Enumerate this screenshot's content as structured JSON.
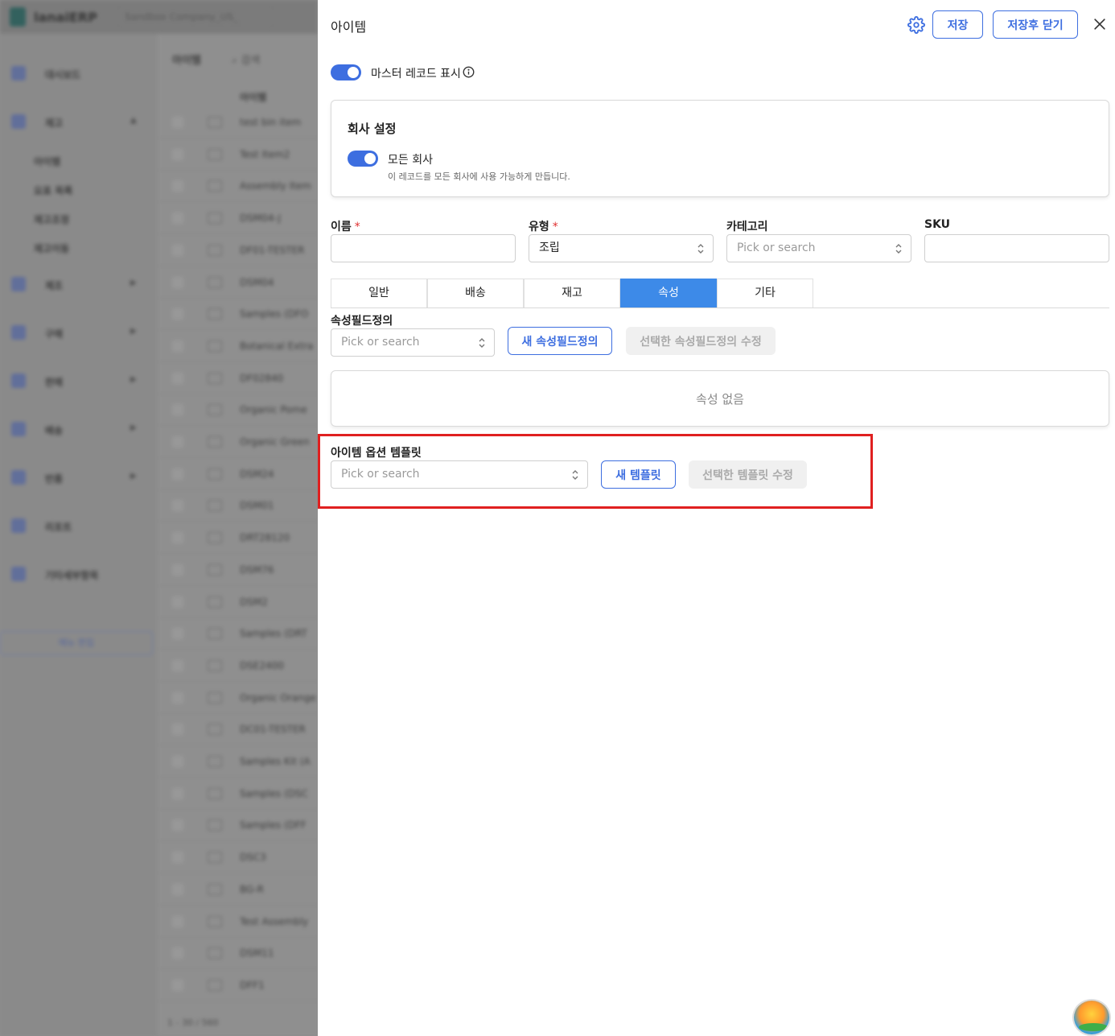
{
  "background": {
    "brand": "lanaiERP",
    "company": "Sandbox Company_US_",
    "sidebar": [
      {
        "label": "대시보드",
        "has_children": false
      },
      {
        "label": "재고",
        "has_children": true
      },
      {
        "label": "제조",
        "has_children": true
      },
      {
        "label": "구매",
        "has_children": true
      },
      {
        "label": "판매",
        "has_children": true
      },
      {
        "label": "배송",
        "has_children": true
      },
      {
        "label": "반품",
        "has_children": true
      },
      {
        "label": "리포트",
        "has_children": false
      },
      {
        "label": "기타세부항목",
        "has_children": false
      }
    ],
    "sidebar_sub": [
      "아이템",
      "요표 목록",
      "재고조정",
      "재고이동"
    ],
    "sidebar_button": "메뉴 편집",
    "list_header": "아이템",
    "search_placeholder": "검색",
    "list_column": "아이템",
    "list_rows": [
      "test bin item",
      "Test Item2",
      "Assembly Item",
      "DSM04-J",
      "DF01-TESTER",
      "DSM04",
      "Samples (DFO",
      "Botanical Extra",
      "DF02840",
      "Organic Pome",
      "Organic Green",
      "DSM24",
      "DSM01",
      "DRT28120",
      "DSM76",
      "DSM2",
      "Samples (DRT",
      "DSE2400",
      "Organic Orange",
      "DC01-TESTER",
      "Samples Kit (A",
      "Samples (DSC",
      "Samples (DFF",
      "DSC3",
      "BG-R",
      "Test Assembly",
      "DSM11",
      "DFF1"
    ],
    "footer": "1 - 30 / 560"
  },
  "drawer": {
    "title": "아이템",
    "save_label": "저장",
    "save_close_label": "저장후 닫기",
    "master_record_label": "마스터 레코드 표시",
    "company_settings": {
      "title": "회사 설정",
      "all_companies_label": "모든 회사",
      "description": "이 레코드를 모든 회사에 사용 가능하게 만듭니다."
    },
    "fields": {
      "name_label": "이름",
      "name_value": "",
      "type_label": "유형",
      "type_value": "조립",
      "category_label": "카테고리",
      "category_placeholder": "Pick or search",
      "sku_label": "SKU",
      "sku_value": "",
      "required_mark": "*"
    },
    "tabs": [
      {
        "label": "일반",
        "active": false
      },
      {
        "label": "배송",
        "active": false
      },
      {
        "label": "재고",
        "active": false
      },
      {
        "label": "속성",
        "active": true
      },
      {
        "label": "기타",
        "active": false
      }
    ],
    "attributes": {
      "label": "속성필드정의",
      "placeholder": "Pick or search",
      "new_button": "새 속성필드정의",
      "edit_button": "선택한 속성필드정의 수정",
      "empty_text": "속성 없음"
    },
    "option_template": {
      "label": "아이템 옵션 템플릿",
      "placeholder": "Pick or search",
      "new_button": "새 템플릿",
      "edit_button": "선택한 템플릿 수정"
    }
  },
  "colors": {
    "accent": "#3d6ee0",
    "active_tab": "#3d8ae8",
    "highlight": "#e02020"
  }
}
